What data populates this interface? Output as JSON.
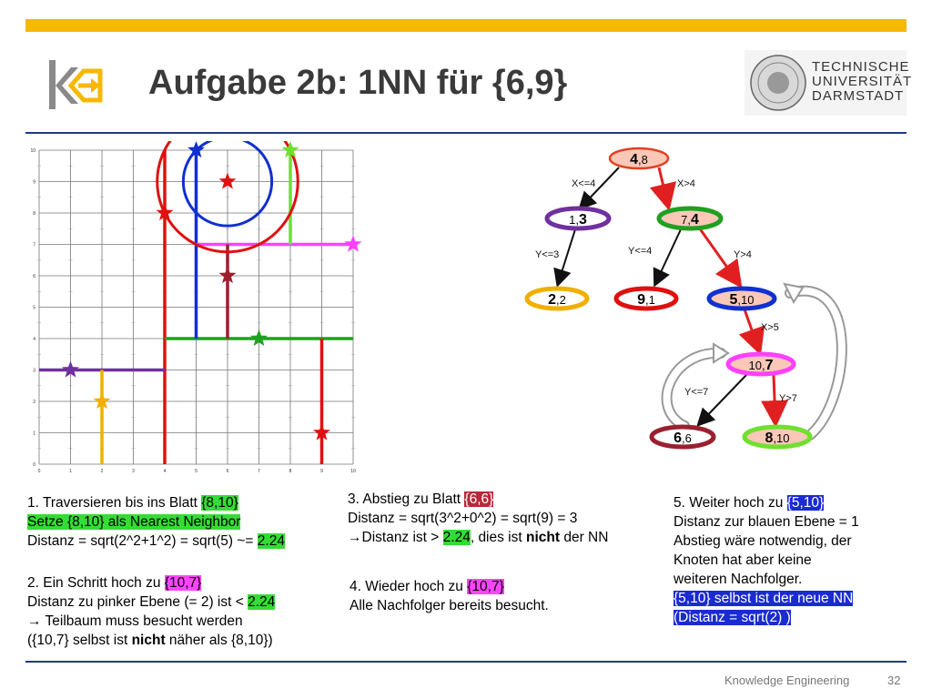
{
  "header": {
    "title": "Aufgabe 2b: 1NN für {6,9}",
    "university_lines": [
      "TECHNISCHE",
      "UNIVERSITÄT",
      "DARMSTADT"
    ]
  },
  "footer": {
    "course": "Knowledge Engineering",
    "page": "32"
  },
  "grid": {
    "x_ticks": [
      "0",
      "1",
      "2",
      "3",
      "4",
      "5",
      "6",
      "7",
      "8",
      "9",
      "10"
    ],
    "y_ticks": [
      "0",
      "1",
      "2",
      "3",
      "4",
      "5",
      "6",
      "7",
      "8",
      "9",
      "10"
    ],
    "grid_on": true
  },
  "colors": {
    "accent_bar": "#f6b800",
    "rule": "#1f3a8a",
    "purple": "#7030a0",
    "yellow": "#f0b000",
    "red": "#e01010",
    "blue": "#1030d0",
    "darkred": "#9a2030",
    "green": "#20a020",
    "lime": "#70e030",
    "magenta": "#ff40ff"
  },
  "tree": {
    "nodes": [
      {
        "id": "n48",
        "a": "4",
        "b": ",8"
      },
      {
        "id": "n13",
        "a": "1,",
        "b": "3"
      },
      {
        "id": "n74",
        "a": "7,",
        "b": "4"
      },
      {
        "id": "n22",
        "a": "2",
        "b": ",2"
      },
      {
        "id": "n91",
        "a": "9",
        "b": ",1"
      },
      {
        "id": "n510",
        "a": "5",
        "b": ",10"
      },
      {
        "id": "n107",
        "a": "10,",
        "b": "7"
      },
      {
        "id": "n66",
        "a": "6",
        "b": ",6"
      },
      {
        "id": "n810",
        "a": "8",
        "b": ",10"
      }
    ],
    "edge_labels": [
      "X<=4",
      "X>4",
      "Y<=3",
      "Y<=4",
      "Y>4",
      "X>5",
      "Y<=7",
      "Y>7"
    ]
  },
  "steps": {
    "s1": {
      "l1_pre": "1. Traversieren bis ins Blatt ",
      "l1_hl": "{8,10}",
      "l2_hl": "Setze {8,10} als Nearest Neighbor",
      "l3_pre": "Distanz = sqrt(2^2+1^2) = sqrt(5) ~= ",
      "l3_hl": "2.24"
    },
    "s2": {
      "l1_pre": "2. Ein Schritt hoch zu ",
      "l1_hl": "{10,7}",
      "l2_pre": "Distanz zu pinker Ebene (= 2) ist < ",
      "l2_hl": "2.24",
      "l3": "→  Teilbaum muss besucht werden",
      "l4_pre": "({10,7} selbst ist ",
      "l4_bold": "nicht",
      "l4_post": " näher als {8,10})"
    },
    "s3": {
      "l1_pre": "3. Abstieg zu Blatt ",
      "l1_hl": "{6,6}",
      "l2": "Distanz = sqrt(3^2+0^2) = sqrt(9) = 3",
      "l3_pre": "→Distanz ist > ",
      "l3_hl": "2.24",
      "l3_mid": ", dies ist ",
      "l3_bold": "nicht",
      "l3_post": " der NN"
    },
    "s4": {
      "l1_pre": "4. Wieder hoch zu ",
      "l1_hl": "{10,7}",
      "l2": "Alle Nachfolger bereits besucht."
    },
    "s5": {
      "l1_pre": "5. Weiter hoch zu ",
      "l1_hl": "{5,10}",
      "l2": "Distanz zur blauen Ebene = 1",
      "l3": "Abstieg wäre notwendig, der",
      "l4": "Knoten  hat aber keine",
      "l5": "weiteren Nachfolger.",
      "l6_hl": "{5,10} selbst ist der neue NN",
      "l7_hl": "(Distanz = sqrt(2) )"
    }
  }
}
